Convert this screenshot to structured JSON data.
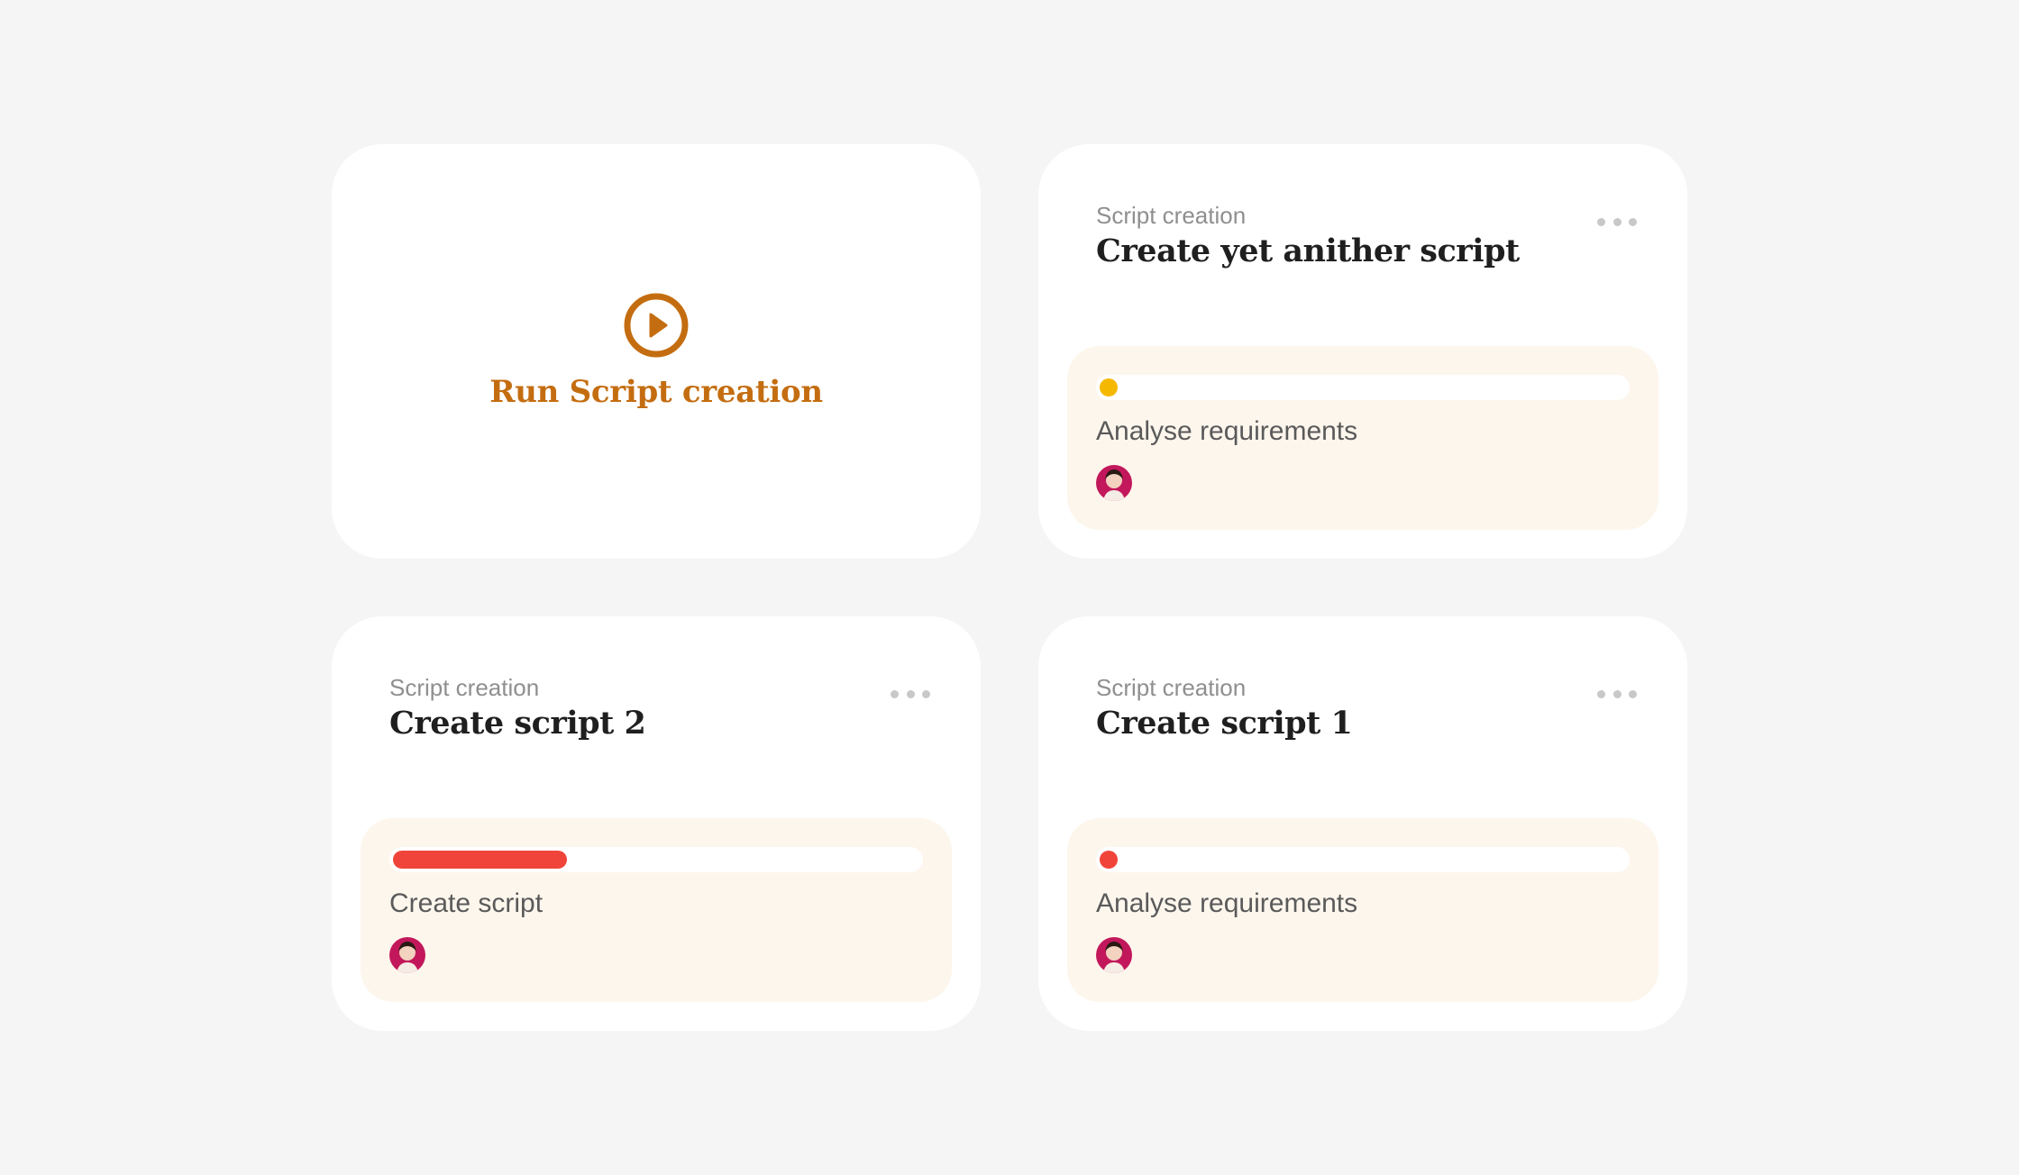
{
  "run_card": {
    "label": "Run Script creation",
    "icon": "play-circle-icon",
    "accent_color": "#c46d10"
  },
  "cards": [
    {
      "category": "Script creation",
      "title": "Create yet anither script",
      "task": {
        "label": "Analyse requirements",
        "progress_percent": 0,
        "progress_color": "#f5b800"
      },
      "assignee_avatar": "avatar"
    },
    {
      "category": "Script creation",
      "title": "Create script 2",
      "task": {
        "label": "Create script",
        "progress_percent": 33,
        "progress_color": "#f0443a"
      },
      "assignee_avatar": "avatar"
    },
    {
      "category": "Script creation",
      "title": "Create script 1",
      "task": {
        "label": "Analyse requirements",
        "progress_percent": 0,
        "progress_color": "#f0443a"
      },
      "assignee_avatar": "avatar"
    }
  ],
  "more_icon": "more-horizontal-icon",
  "panel_color": "#fdf6ed"
}
